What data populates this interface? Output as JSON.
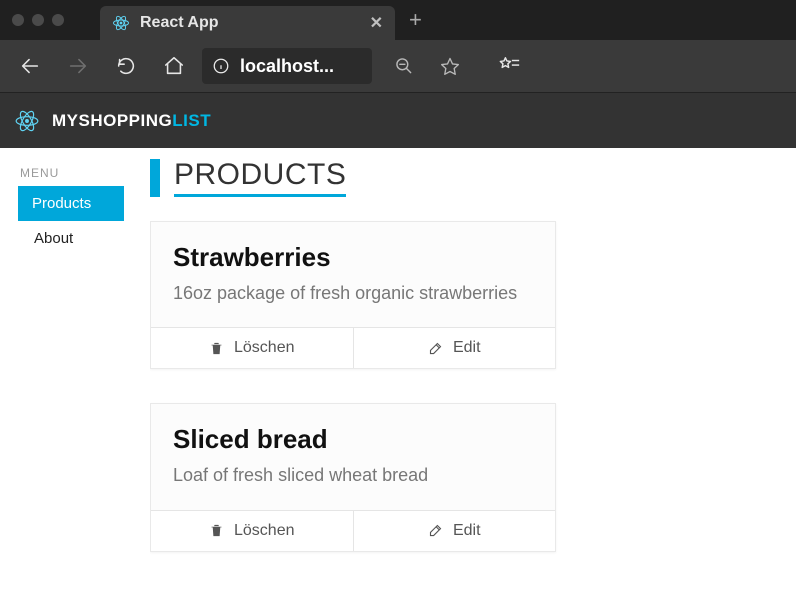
{
  "browser": {
    "tab_title": "React App",
    "url_text": "localhost..."
  },
  "app": {
    "brand_prefix": "MY",
    "brand_mid": "SHOPPING",
    "brand_accent": "LIST"
  },
  "sidebar": {
    "label": "MENU",
    "items": [
      {
        "label": "Products",
        "active": true
      },
      {
        "label": "About",
        "active": false
      }
    ]
  },
  "page": {
    "title": "PRODUCTS"
  },
  "products": [
    {
      "title": "Strawberries",
      "description": "16oz package of fresh organic strawberries",
      "delete_label": "Löschen",
      "edit_label": "Edit"
    },
    {
      "title": "Sliced bread",
      "description": "Loaf of fresh sliced wheat bread",
      "delete_label": "Löschen",
      "edit_label": "Edit"
    }
  ]
}
